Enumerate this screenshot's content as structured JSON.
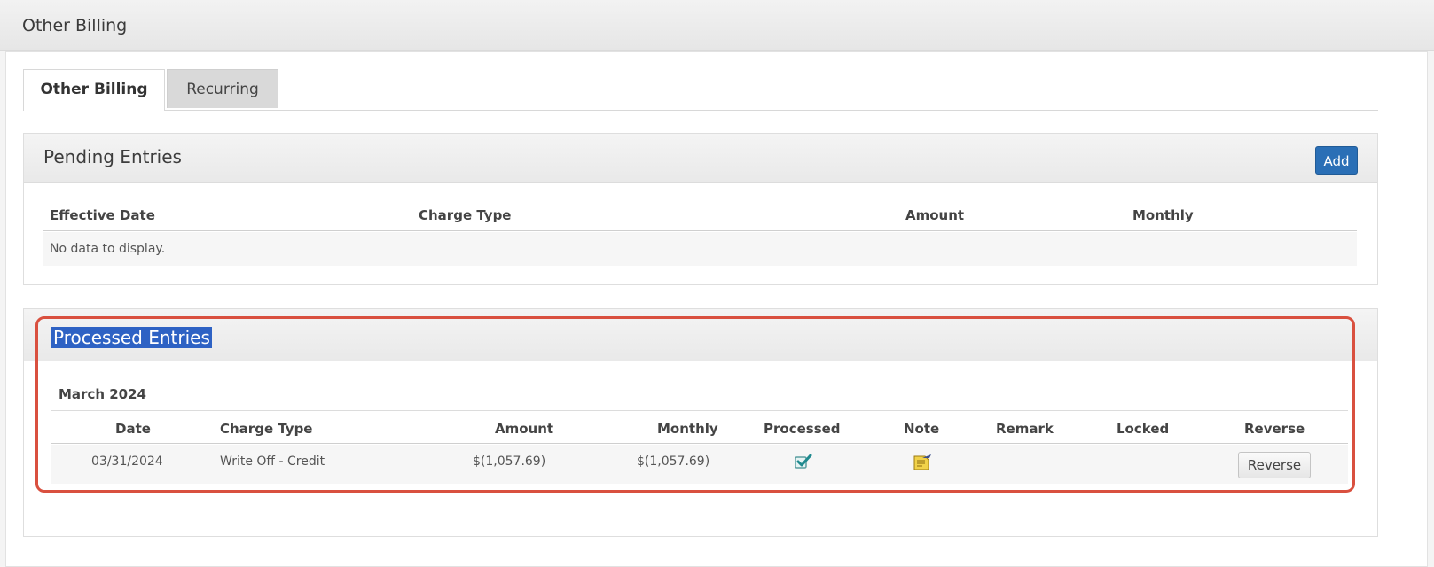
{
  "header": {
    "title": "Other Billing"
  },
  "tabs": [
    {
      "label": "Other Billing",
      "active": true
    },
    {
      "label": "Recurring",
      "active": false
    }
  ],
  "pending": {
    "title": "Pending Entries",
    "add_label": "Add",
    "columns": [
      "Effective Date",
      "Charge Type",
      "Amount",
      "Monthly"
    ],
    "empty_text": "No data to display."
  },
  "processed": {
    "title": "Processed Entries",
    "group_label": "March 2024",
    "columns": [
      "Date",
      "Charge Type",
      "Amount",
      "Monthly",
      "Processed",
      "Note",
      "Remark",
      "Locked",
      "Reverse"
    ],
    "rows": [
      {
        "date": "03/31/2024",
        "charge_type": "Write Off - Credit",
        "amount": "$(1,057.69)",
        "monthly": "$(1,057.69)",
        "processed_icon": "checkbox-checked-icon",
        "note_icon": "note-icon",
        "remark": "",
        "locked": "",
        "reverse_label": "Reverse"
      }
    ]
  },
  "colors": {
    "accent": "#2a6fb6",
    "highlight_border": "#d9503f",
    "selection": "#2e62c4"
  }
}
